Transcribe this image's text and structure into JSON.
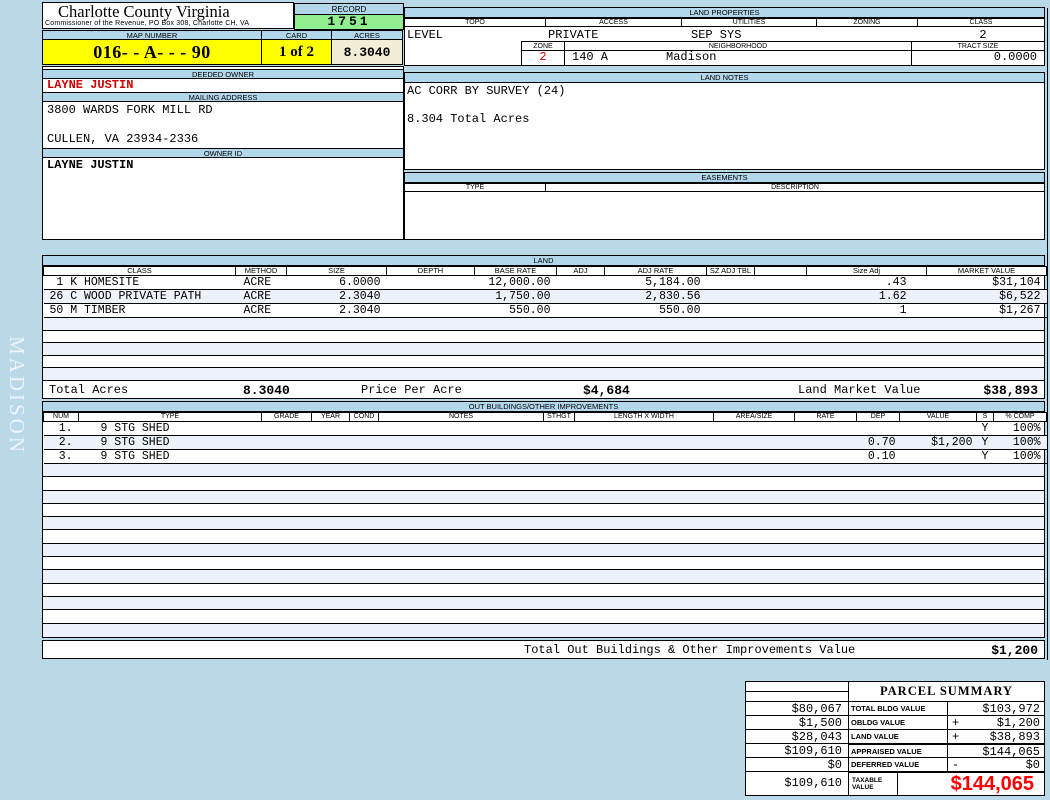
{
  "header": {
    "county_name": "Charlotte County Virginia",
    "commissioner_line": "Commissioner of the Revenue, PO Box 308, Charlotte CH, VA",
    "record_label": "RECORD",
    "record_number": "1751",
    "map_number_label": "MAP NUMBER",
    "map_number": "016- - A- - - 90",
    "card_label": "CARD",
    "card": "1 of 2",
    "acres_label": "ACRES",
    "acres": "8.3040"
  },
  "district": "MADISON",
  "owner": {
    "deeded_owner_label": "DEEDED OWNER",
    "deeded_owner": "LAYNE JUSTIN",
    "mailing_address_label": "MAILING ADDRESS",
    "address_line1": "3800 WARDS FORK MILL RD",
    "address_line2": "CULLEN, VA 23934-2336",
    "owner_id_label": "OWNER ID",
    "owner_id": "LAYNE JUSTIN"
  },
  "land_properties": {
    "title": "LAND PROPERTIES",
    "col_topo": "TOPO",
    "col_access": "ACCESS",
    "col_utilities": "UTILITIES",
    "col_zoning": "ZONING",
    "col_class": "CLASS",
    "topo": "LEVEL",
    "access": "PRIVATE",
    "utilities": "SEP SYS",
    "zoning": "",
    "class": "2",
    "zone_label": "ZONE",
    "zone": "2",
    "neighborhood_label": "NEIGHBORHOOD",
    "neighborhood_code": "140 A",
    "neighborhood_name": "Madison",
    "tract_size_label": "TRACT SIZE",
    "tract_size": "0.0000"
  },
  "land_notes": {
    "title": "LAND NOTES",
    "note1": "AC CORR BY SURVEY (24)",
    "note2": "8.304 Total Acres"
  },
  "easements": {
    "title": "EASEMENTS",
    "col_type": "TYPE",
    "col_description": "DESCRIPTION"
  },
  "land": {
    "title": "LAND",
    "columns": [
      "CLASS",
      "METHOD",
      "SIZE",
      "DEPTH",
      "BASE RATE",
      "ADJ",
      "ADJ RATE",
      "SZ ADJ TBL",
      "",
      "Size Adj",
      "MARKET VALUE"
    ],
    "rows": [
      {
        "class_desc": " 1 K HOMESITE",
        "method": "ACRE",
        "size": "6.0000",
        "depth": "",
        "base_rate": "12,000.00",
        "adj": "",
        "adj_rate": "5,184.00",
        "sz_adj_tbl": "",
        "size_adj": ".43",
        "market_value": "$31,104"
      },
      {
        "class_desc": "26 C WOOD PRIVATE PATH",
        "method": "ACRE",
        "size": "2.3040",
        "depth": "",
        "base_rate": "1,750.00",
        "adj": "",
        "adj_rate": "2,830.56",
        "sz_adj_tbl": "",
        "size_adj": "1.62",
        "market_value": "$6,522"
      },
      {
        "class_desc": "50 M TIMBER",
        "method": "ACRE",
        "size": "2.3040",
        "depth": "",
        "base_rate": "550.00",
        "adj": "",
        "adj_rate": "550.00",
        "sz_adj_tbl": "",
        "size_adj": "1",
        "market_value": "$1,267"
      }
    ],
    "total_acres_label": "Total Acres",
    "total_acres": "8.3040",
    "price_per_acre_label": "Price Per Acre",
    "price_per_acre": "$4,684",
    "land_market_value_label": "Land Market Value",
    "land_market_value": "$38,893"
  },
  "out_buildings": {
    "title": "OUT BUILDINGS/OTHER IMPROVEMENTS",
    "columns": [
      "NUM",
      "TYPE",
      "GRADE",
      "YEAR",
      "COND",
      "NOTES",
      "STHGT",
      "LENGTH X WIDTH",
      "AREA/SIZE",
      "RATE",
      "DEP",
      "VALUE",
      "S",
      "% COMP"
    ],
    "rows": [
      {
        "num": "1.",
        "type": "9 STG SHED",
        "grade": "",
        "year": "",
        "cond": "",
        "notes": "",
        "sthgt": "",
        "length_width": "",
        "area_size": "",
        "rate": "",
        "dep": "",
        "value": "",
        "s": "Y",
        "pct_comp": "100%"
      },
      {
        "num": "2.",
        "type": "9 STG SHED",
        "grade": "",
        "year": "",
        "cond": "",
        "notes": "",
        "sthgt": "",
        "length_width": "",
        "area_size": "",
        "rate": "",
        "dep": "0.70",
        "value": "$1,200",
        "s": "Y",
        "pct_comp": "100%"
      },
      {
        "num": "3.",
        "type": "9 STG SHED",
        "grade": "",
        "year": "",
        "cond": "",
        "notes": "",
        "sthgt": "",
        "length_width": "",
        "area_size": "",
        "rate": "",
        "dep": "0.10",
        "value": "",
        "s": "Y",
        "pct_comp": "100%"
      }
    ],
    "total_label": "Total Out Buildings & Other Improvements Value",
    "total_value": "$1,200"
  },
  "parcel_summary": {
    "title": "PARCEL SUMMARY",
    "rows": [
      {
        "prior": "$80,067",
        "label": "TOTAL BLDG VALUE",
        "sign": "",
        "value": "$103,972"
      },
      {
        "prior": "$1,500",
        "label": "OBLDG VALUE",
        "sign": "+",
        "value": "$1,200"
      },
      {
        "prior": "$28,043",
        "label": "LAND VALUE",
        "sign": "+",
        "value": "$38,893"
      },
      {
        "prior": "$109,610",
        "label": "APPRAISED VALUE",
        "sign": "",
        "value": "$144,065"
      },
      {
        "prior": "$0",
        "label": "DEFERRED VALUE",
        "sign": "-",
        "value": "$0"
      }
    ],
    "taxable_prior": "$109,610",
    "taxable_label": "TAXABLE VALUE",
    "taxable_value": "$144,065"
  },
  "colors": {
    "page_bg": "#b9d8e8",
    "section_bar": "#b3d7ea",
    "highlight_yellow": "#ffff00",
    "record_green": "#90ee90",
    "acres_cream": "#f2edd7",
    "row_stripe": "#edf1f9",
    "owner_red": "#cc0000",
    "taxable_red": "#ff0000"
  }
}
